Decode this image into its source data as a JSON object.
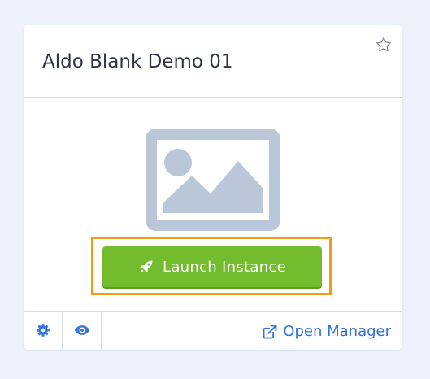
{
  "card": {
    "title": "Aldo Blank Demo 01",
    "favorite_icon": "star-outline-icon",
    "image_icon": "image-placeholder-icon"
  },
  "launch_button": {
    "label": "Launch Instance",
    "icon": "rocket-icon"
  },
  "footer": {
    "settings_icon": "gear-icon",
    "preview_icon": "eye-icon",
    "open_manager_label": "Open Manager",
    "open_manager_icon": "external-link-icon"
  },
  "colors": {
    "background": "#eef3fb",
    "button_green": "#72bc2e",
    "highlight_orange": "#f59a14",
    "link_blue": "#2f6fe0",
    "placeholder_gray": "#b9c7d8"
  }
}
